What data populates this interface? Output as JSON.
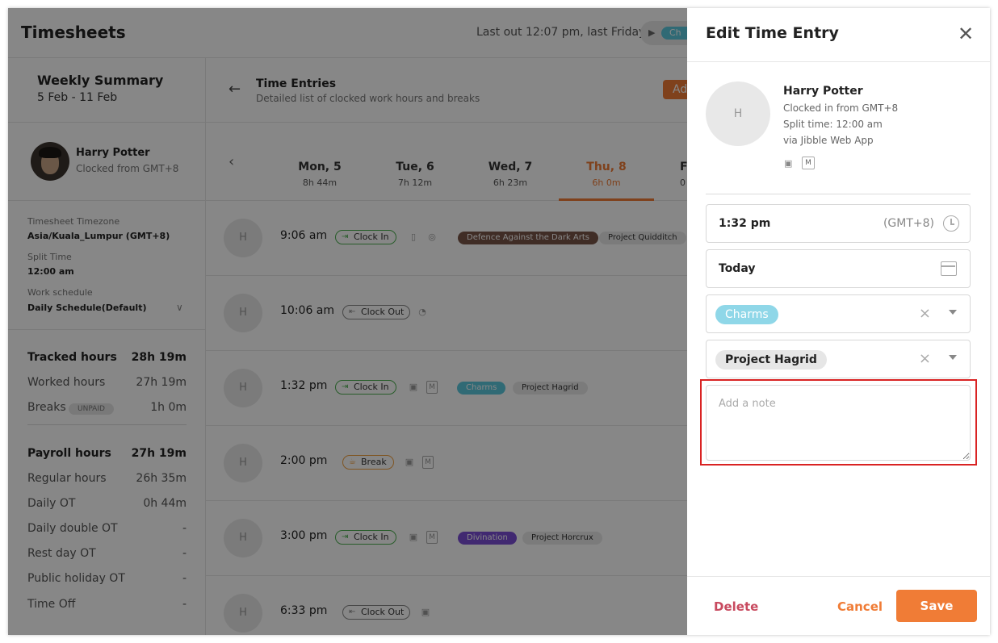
{
  "app": {
    "title": "Timesheets",
    "last_out": "Last out 12:07 pm, last Friday",
    "play_icon": "▶",
    "clock_chip": "Ch"
  },
  "sidebar": {
    "weekly_title": "Weekly Summary",
    "week_range": "5 Feb - 11 Feb",
    "user_name": "Harry Potter",
    "user_sub": "Clocked from GMT+8",
    "timezone_label": "Timesheet Timezone",
    "timezone_value": "Asia/Kuala_Lumpur (GMT+8)",
    "split_label": "Split Time",
    "split_value": "12:00 am",
    "schedule_label": "Work schedule",
    "schedule_value": "Daily Schedule(Default)",
    "chevron": "∨",
    "tracked": {
      "label": "Tracked hours",
      "value": "28h 19m"
    },
    "worked": {
      "label": "Worked hours",
      "value": "27h 19m"
    },
    "breaks": {
      "label": "Breaks",
      "badge": "UNPAID",
      "value": "1h 0m"
    },
    "payroll": {
      "label": "Payroll hours",
      "value": "27h 19m"
    },
    "regular": {
      "label": "Regular hours",
      "value": "26h 35m"
    },
    "daily_ot": {
      "label": "Daily OT",
      "value": "0h 44m"
    },
    "daily_double_ot": {
      "label": "Daily double OT",
      "value": "-"
    },
    "rest_day_ot": {
      "label": "Rest day OT",
      "value": "-"
    },
    "public_holiday_ot": {
      "label": "Public holiday OT",
      "value": "-"
    },
    "time_off": {
      "label": "Time Off",
      "value": "-"
    }
  },
  "main": {
    "back_arrow": "←",
    "title": "Time Entries",
    "subtitle": "Detailed list of clocked work hours and breaks",
    "add_button": "Ad",
    "prev_arrow": "‹",
    "days": [
      {
        "day": "Mon, 5",
        "hours": "8h 44m"
      },
      {
        "day": "Tue, 6",
        "hours": "7h 12m"
      },
      {
        "day": "Wed, 7",
        "hours": "6h 23m"
      },
      {
        "day": "Thu, 8",
        "hours": "6h 0m"
      },
      {
        "day": "F",
        "hours": "0"
      }
    ],
    "entries": [
      {
        "avatar": "H",
        "time": "9:06 am",
        "action": "Clock In",
        "activity": "Defence Against the Dark Arts",
        "project": "Project Quidditch"
      },
      {
        "avatar": "H",
        "time": "10:06 am",
        "action": "Clock Out"
      },
      {
        "avatar": "H",
        "time": "1:32 pm",
        "action": "Clock In",
        "activity": "Charms",
        "project": "Project Hagrid",
        "m": "M"
      },
      {
        "avatar": "H",
        "time": "2:00 pm",
        "action": "Break",
        "m": "M"
      },
      {
        "avatar": "H",
        "time": "3:00 pm",
        "action": "Clock In",
        "activity": "Divination",
        "project": "Project Horcrux",
        "m": "M"
      },
      {
        "avatar": "H",
        "time": "6:33 pm",
        "action": "Clock Out"
      }
    ]
  },
  "panel": {
    "title": "Edit Time Entry",
    "close_icon": "✕",
    "avatar": "H",
    "name": "Harry Potter",
    "clocked_in": "Clocked in from GMT+8",
    "split_time": "Split time: 12:00 am",
    "via": "via Jibble Web App",
    "m_badge": "M",
    "time_value": "1:32 pm",
    "tz_value": "(GMT+8)",
    "date_value": "Today",
    "activity": "Charms",
    "project": "Project Hagrid",
    "clear_icon": "×",
    "note_placeholder": "Add a note",
    "delete_label": "Delete",
    "cancel_label": "Cancel",
    "save_label": "Save"
  },
  "colors": {
    "accent": "#f07c36",
    "defence_tag": "#7a5548",
    "charms_tag": "#5cc8de",
    "divination_tag": "#7b4fd6",
    "clock_in_border": "#4caf50",
    "delete_text": "#c84a5f",
    "highlight_border": "#d92323"
  }
}
